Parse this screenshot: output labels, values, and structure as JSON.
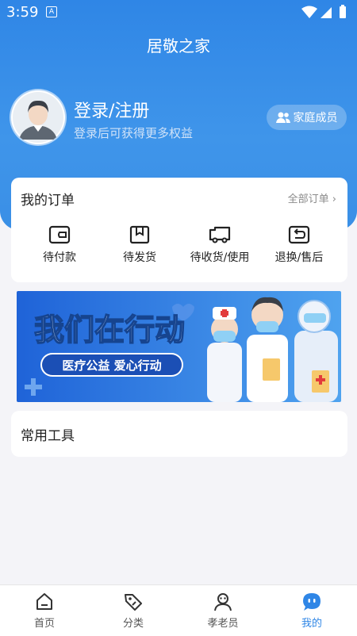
{
  "status_bar": {
    "time": "3:59",
    "indicator": "A"
  },
  "header": {
    "title": "居敬之家"
  },
  "profile": {
    "login_title": "登录/注册",
    "login_subtitle": "登录后可获得更多权益",
    "family_button": "家庭成员"
  },
  "orders": {
    "title": "我的订单",
    "all_link": "全部订单",
    "items": [
      {
        "label": "待付款",
        "icon": "wallet-icon"
      },
      {
        "label": "待发货",
        "icon": "package-icon"
      },
      {
        "label": "待收货/使用",
        "icon": "truck-icon"
      },
      {
        "label": "退换/售后",
        "icon": "return-icon"
      }
    ]
  },
  "banner": {
    "headline": "我们在行动",
    "tagline": "医疗公益  爱心行动"
  },
  "tools": {
    "title": "常用工具"
  },
  "tabbar": {
    "items": [
      {
        "label": "首页",
        "icon": "home-icon"
      },
      {
        "label": "分类",
        "icon": "tag-icon"
      },
      {
        "label": "孝老员",
        "icon": "caregiver-icon"
      },
      {
        "label": "我的",
        "icon": "profile-chat-icon"
      }
    ],
    "active": "我的"
  },
  "colors": {
    "primary": "#2f86e6",
    "background": "#f4f4f8"
  }
}
